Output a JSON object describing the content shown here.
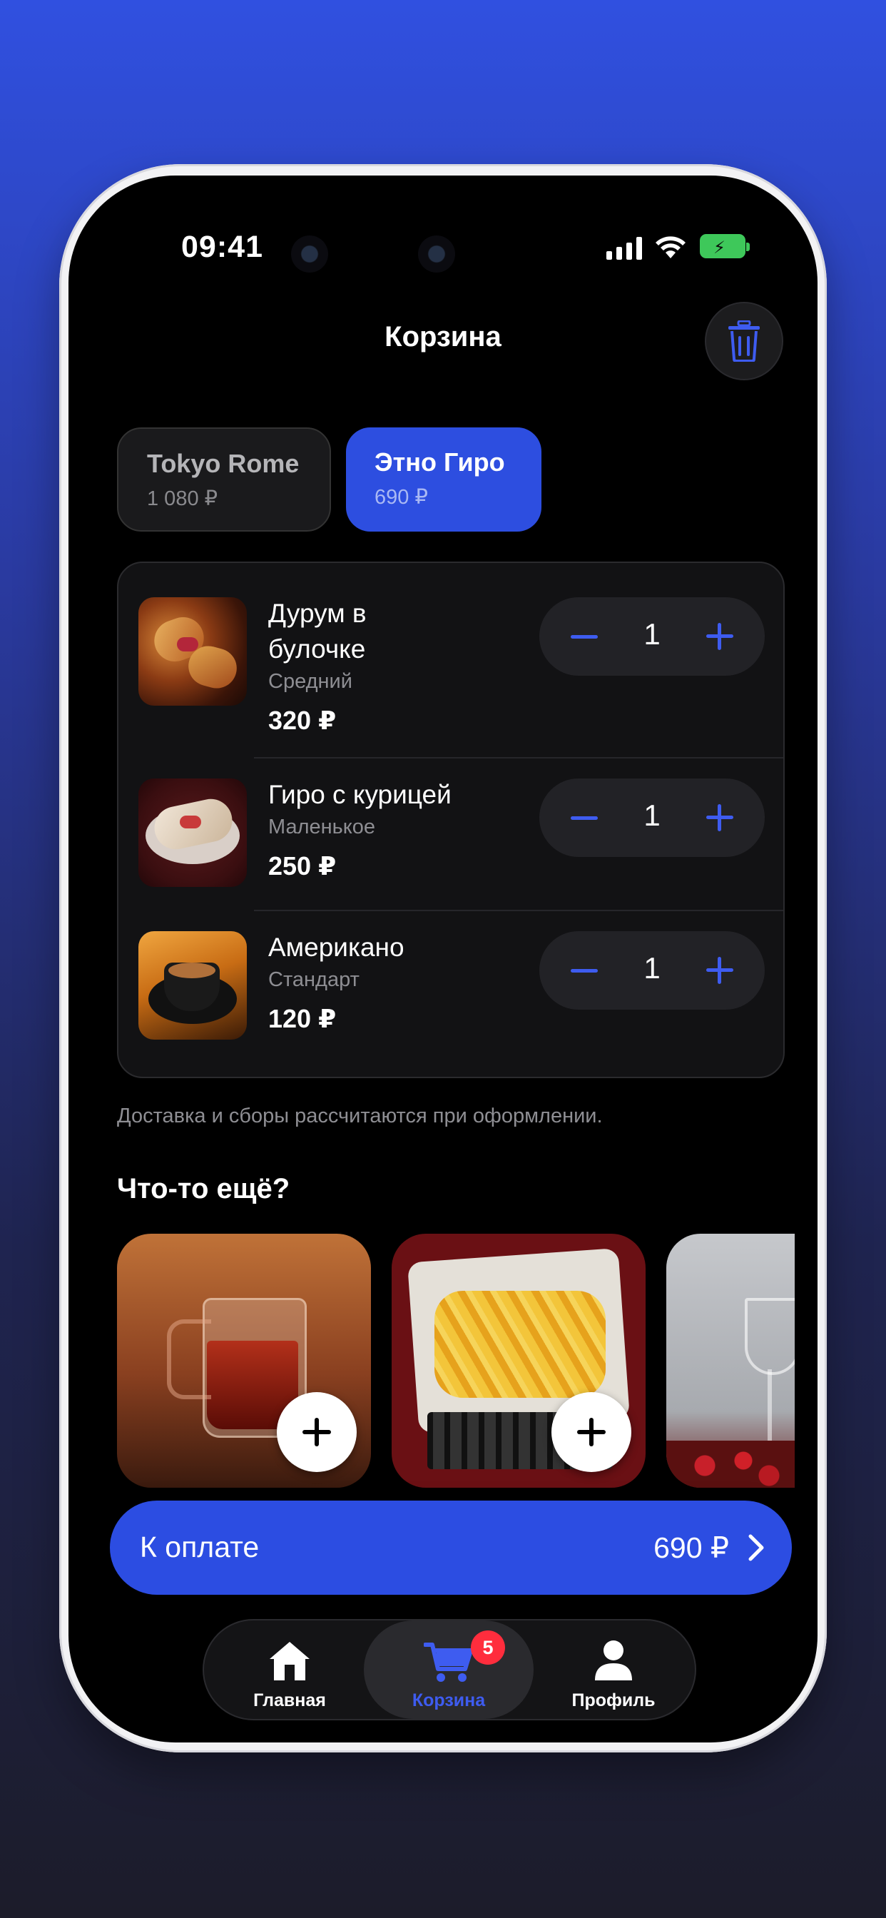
{
  "status": {
    "time": "09:41"
  },
  "header": {
    "title": "Корзина"
  },
  "restaurants": [
    {
      "name": "Tokyo Rome",
      "price": "1 080 ₽"
    },
    {
      "name": "Этно Гиро",
      "price": "690 ₽"
    }
  ],
  "cart": {
    "items": [
      {
        "name": "Дурум в булочке",
        "variant": "Средний",
        "price": "320 ₽",
        "qty": "1"
      },
      {
        "name": "Гиро с курицей",
        "variant": "Маленькое",
        "price": "250 ₽",
        "qty": "1"
      },
      {
        "name": "Американо",
        "variant": "Стандарт",
        "price": "120 ₽",
        "qty": "1"
      }
    ]
  },
  "note": "Доставка и сборы рассчитаются при оформлении.",
  "suggestions": {
    "title": "Что-то ещё?"
  },
  "checkout": {
    "label": "К оплате",
    "amount": "690 ₽"
  },
  "tabbar": {
    "items": [
      {
        "label": "Главная",
        "icon": "home-icon"
      },
      {
        "label": "Корзина",
        "icon": "cart-icon",
        "badge": "5"
      },
      {
        "label": "Профиль",
        "icon": "person-icon"
      }
    ]
  },
  "colors": {
    "accent": "#2d4ee0",
    "badge": "#ff2d3d",
    "background": "#000000"
  }
}
